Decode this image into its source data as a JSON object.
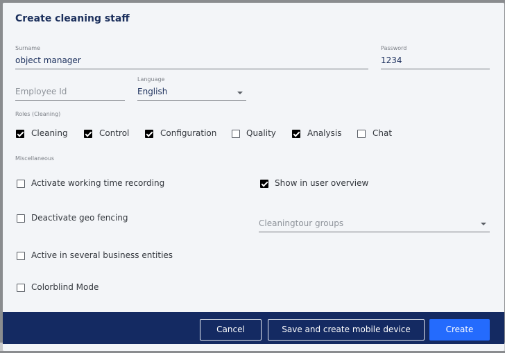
{
  "background": {
    "partial_text": "Yes"
  },
  "dialog": {
    "title": "Create cleaning staff",
    "surname": {
      "label": "Surname",
      "value": "object manager"
    },
    "password": {
      "label": "Password",
      "value": "1234"
    },
    "employee_id": {
      "placeholder": "Employee Id",
      "value": ""
    },
    "language": {
      "label": "Language",
      "value": "English"
    },
    "roles": {
      "label": "Roles (Cleaning)",
      "items": [
        {
          "label": "Cleaning",
          "checked": true
        },
        {
          "label": "Control",
          "checked": true
        },
        {
          "label": "Configuration",
          "checked": true
        },
        {
          "label": "Quality",
          "checked": false
        },
        {
          "label": "Analysis",
          "checked": true
        },
        {
          "label": "Chat",
          "checked": false
        }
      ]
    },
    "misc": {
      "label": "Miscellaneous",
      "activate_working_time": {
        "label": "Activate working time recording",
        "checked": false
      },
      "show_in_user_overview": {
        "label": "Show in user overview",
        "checked": true
      },
      "deactivate_geo_fencing": {
        "label": "Deactivate geo fencing",
        "checked": false
      },
      "cleaningtour_groups": {
        "placeholder": "Cleaningtour groups",
        "value": ""
      },
      "active_several_entities": {
        "label": "Active in several business entities",
        "checked": false
      },
      "colorblind_mode": {
        "label": "Colorblind Mode",
        "checked": false
      }
    },
    "footer": {
      "cancel_label": "Cancel",
      "save_mobile_label": "Save and create mobile device",
      "create_label": "Create"
    }
  },
  "colors": {
    "footer_bg": "#142a62",
    "primary_button": "#246bfd",
    "title": "#1b2f5c"
  }
}
